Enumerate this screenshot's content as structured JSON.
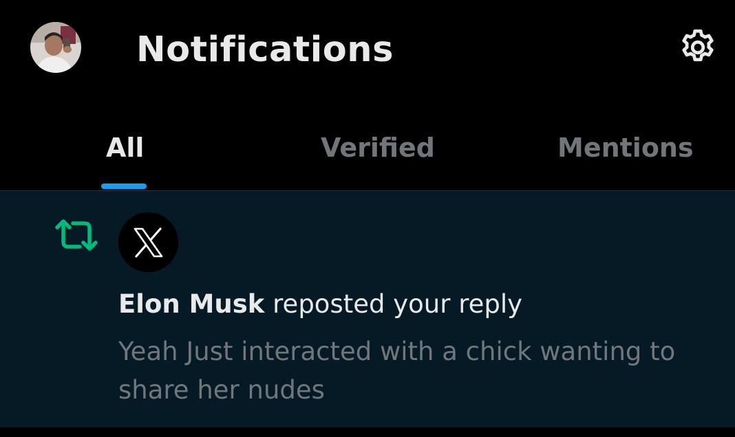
{
  "header": {
    "title": "Notifications",
    "avatar_icon": "user-avatar",
    "settings_icon": "gear-icon"
  },
  "tabs": [
    {
      "label": "All",
      "active": true
    },
    {
      "label": "Verified",
      "active": false
    },
    {
      "label": "Mentions",
      "active": false
    }
  ],
  "notification": {
    "type_icon": "repost-icon",
    "actor_avatar_icon": "x-logo-icon",
    "actor": "Elon Musk",
    "action": " reposted your reply",
    "body": "Yeah Just interacted with a chick wanting to share her nudes"
  },
  "colors": {
    "background": "#000000",
    "notification_bg": "#061a25",
    "text_primary": "#e7e9ea",
    "text_secondary": "#71767b",
    "accent": "#1d9bf0",
    "repost_green": "#00ba7c"
  }
}
